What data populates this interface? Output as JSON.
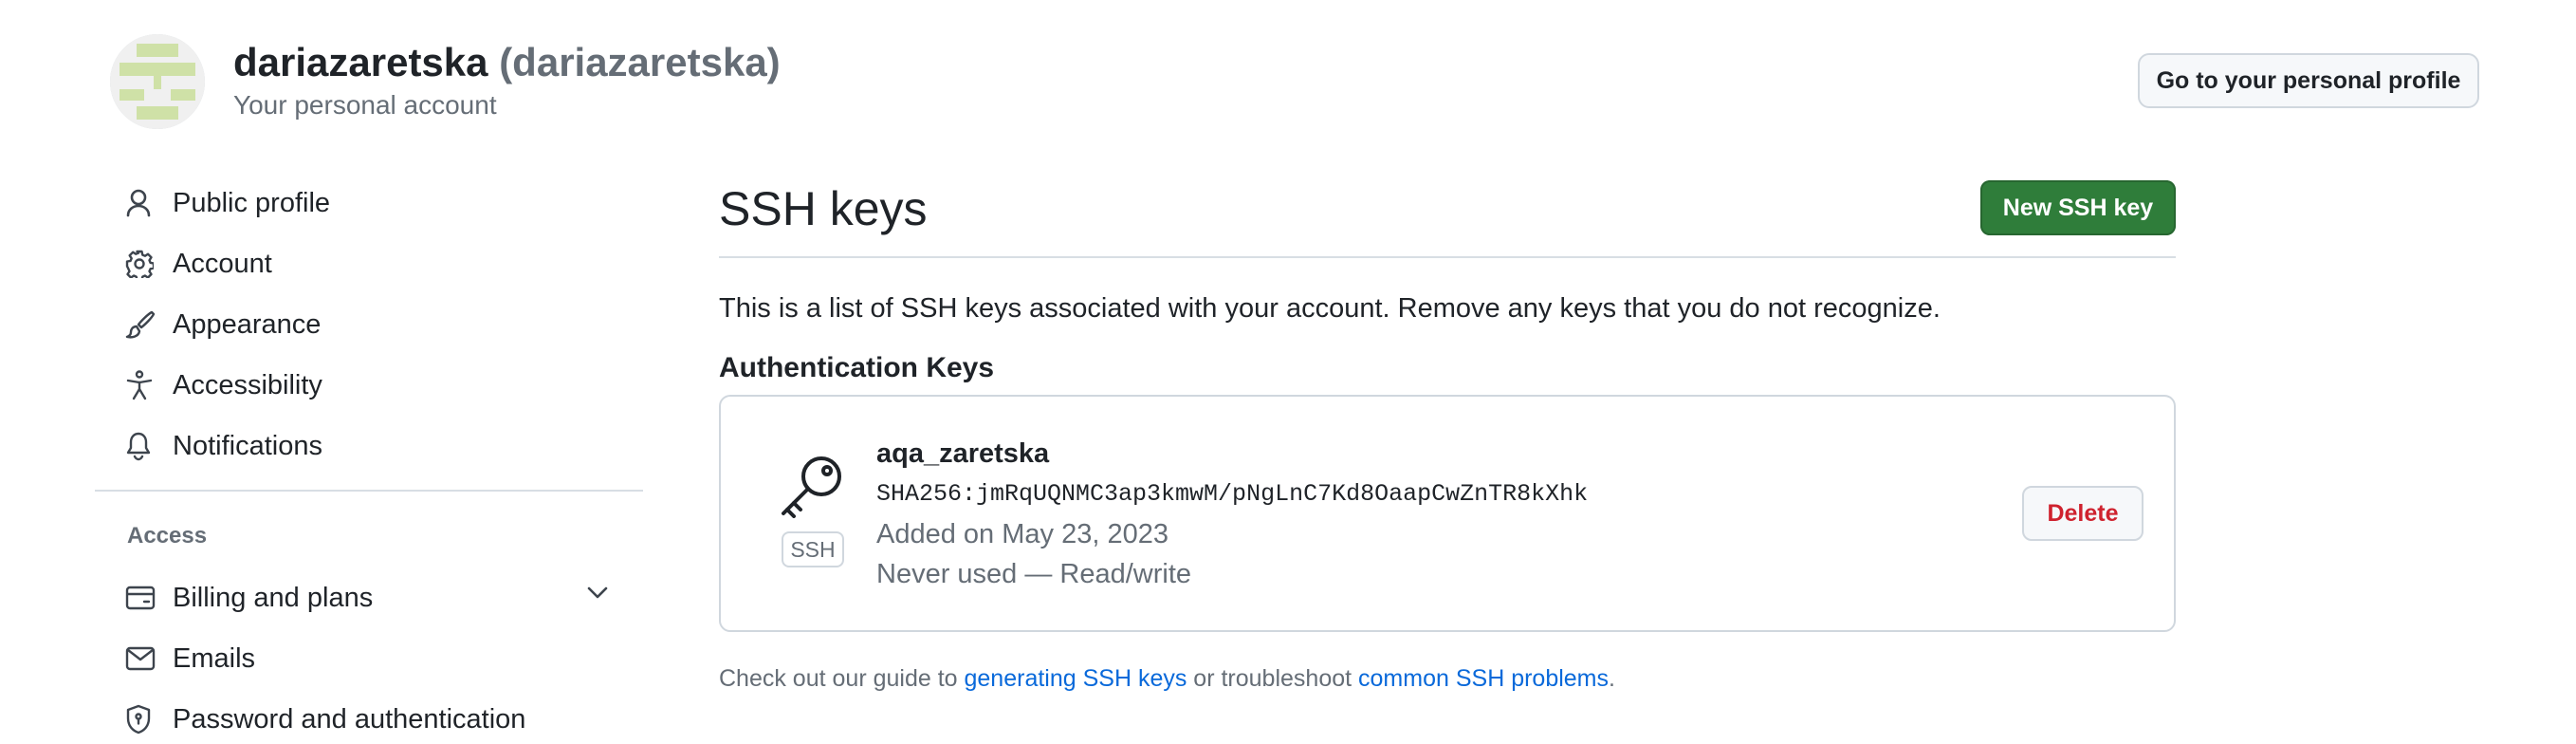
{
  "header": {
    "name": "dariazaretska",
    "login": "(dariazaretska)",
    "subtitle": "Your personal account",
    "profile_button": "Go to your personal profile"
  },
  "sidebar": {
    "items": [
      {
        "label": "Public profile",
        "icon": "person-icon"
      },
      {
        "label": "Account",
        "icon": "gear-icon"
      },
      {
        "label": "Appearance",
        "icon": "paintbrush-icon"
      },
      {
        "label": "Accessibility",
        "icon": "accessibility-icon"
      },
      {
        "label": "Notifications",
        "icon": "bell-icon"
      }
    ],
    "access_heading": "Access",
    "access_items": [
      {
        "label": "Billing and plans",
        "icon": "credit-card-icon",
        "expandable": true
      },
      {
        "label": "Emails",
        "icon": "mail-icon"
      },
      {
        "label": "Password and authentication",
        "icon": "shield-lock-icon"
      }
    ]
  },
  "main": {
    "title": "SSH keys",
    "new_button": "New SSH key",
    "intro": "This is a list of SSH keys associated with your account. Remove any keys that you do not recognize.",
    "section_heading": "Authentication Keys",
    "keys": [
      {
        "title": "aqa_zaretska",
        "fingerprint": "SHA256:jmRqUQNMC3ap3kmwM/pNgLnC7Kd8OaapCwZnTR8kXhk",
        "added": "Added on May 23, 2023",
        "usage": "Never used — Read/write",
        "type_label": "SSH",
        "delete_button": "Delete",
        "icon": "key-icon"
      }
    ],
    "guide": {
      "prefix": "Check out our guide to ",
      "link1": "generating SSH keys",
      "middle": " or troubleshoot ",
      "link2": "common SSH problems",
      "suffix": "."
    }
  },
  "colors": {
    "primary_button": "#2f7d3a",
    "danger_text": "#cf222e",
    "link": "#0969da",
    "muted_text": "#656d76",
    "border": "#d0d7de"
  }
}
